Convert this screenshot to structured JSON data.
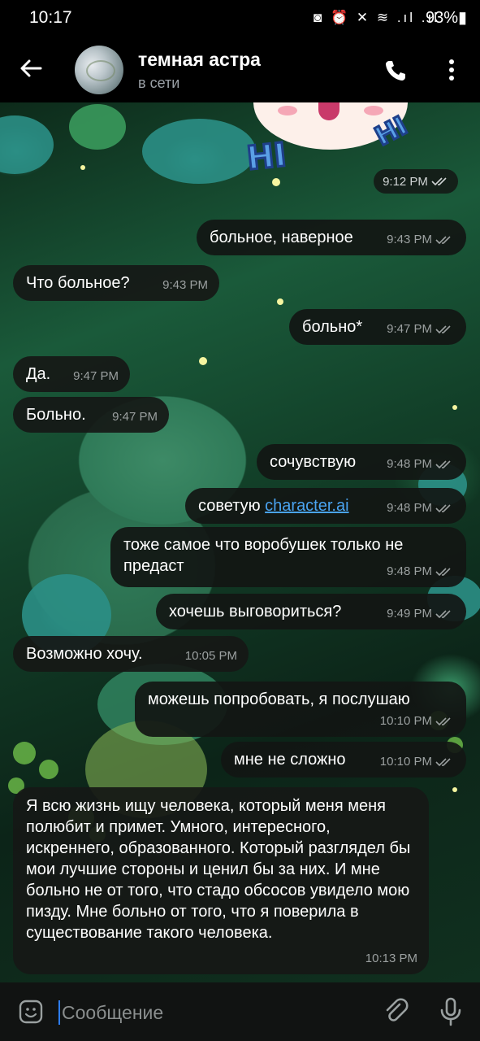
{
  "status_bar": {
    "time": "10:17",
    "icons": "◙ ⏰ ✕ ≋ .ıl .ıl",
    "battery": "93%▮"
  },
  "header": {
    "contact_name": "темная астра",
    "status": "в сети",
    "icons": [
      "back-arrow-icon",
      "phone-icon",
      "more-vertical-icon"
    ]
  },
  "sticker": {
    "hi_left": "HI",
    "hi_right": "HI"
  },
  "messages": [
    {
      "dir": "out",
      "text": "",
      "time": "9:12 PM",
      "read": true,
      "kind": "sticker-time"
    },
    {
      "dir": "out",
      "text": "больное, наверное",
      "time": "9:43 PM",
      "read": true
    },
    {
      "dir": "in",
      "text": "Что больное?",
      "time": "9:43 PM"
    },
    {
      "dir": "out",
      "text": "больно*",
      "time": "9:47 PM",
      "read": true
    },
    {
      "dir": "in",
      "text": "Да.",
      "time": "9:47 PM"
    },
    {
      "dir": "in",
      "text": "Больно.",
      "time": "9:47 PM"
    },
    {
      "dir": "out",
      "text": "сочувствую",
      "time": "9:48 PM",
      "read": true
    },
    {
      "dir": "out",
      "text": "советую ",
      "link": "character.ai",
      "time": "9:48 PM",
      "read": true
    },
    {
      "dir": "out",
      "text": "тоже самое что воробушек только не предаст",
      "time": "9:48 PM",
      "read": true
    },
    {
      "dir": "out",
      "text": "хочешь выговориться?",
      "time": "9:49 PM",
      "read": true
    },
    {
      "dir": "in",
      "text": "Возможно хочу.",
      "time": "10:05 PM"
    },
    {
      "dir": "out",
      "text": "можешь попробовать, я послушаю",
      "time": "10:10 PM",
      "read": true
    },
    {
      "dir": "out",
      "text": "мне не сложно",
      "time": "10:10 PM",
      "read": true
    },
    {
      "dir": "in",
      "text": "Я всю жизнь ищу человека, который меня меня полюбит и примет. Умного, интересного, искреннего, образованного. Который разглядел бы мои лучшие стороны и ценил бы за них. И мне больно не от того, что стадо обсосов увидело мою пизду. Мне больно от того, что я поверила в существование такого человека.",
      "time": "10:13 PM"
    }
  ],
  "input": {
    "placeholder": "Сообщение",
    "icons": [
      "emoji-icon",
      "attach-icon",
      "mic-icon"
    ]
  },
  "colors": {
    "link": "#4aa3f0",
    "bubble": "#161816",
    "meta": "#9ba0a0",
    "cursor": "#2d7df6"
  }
}
